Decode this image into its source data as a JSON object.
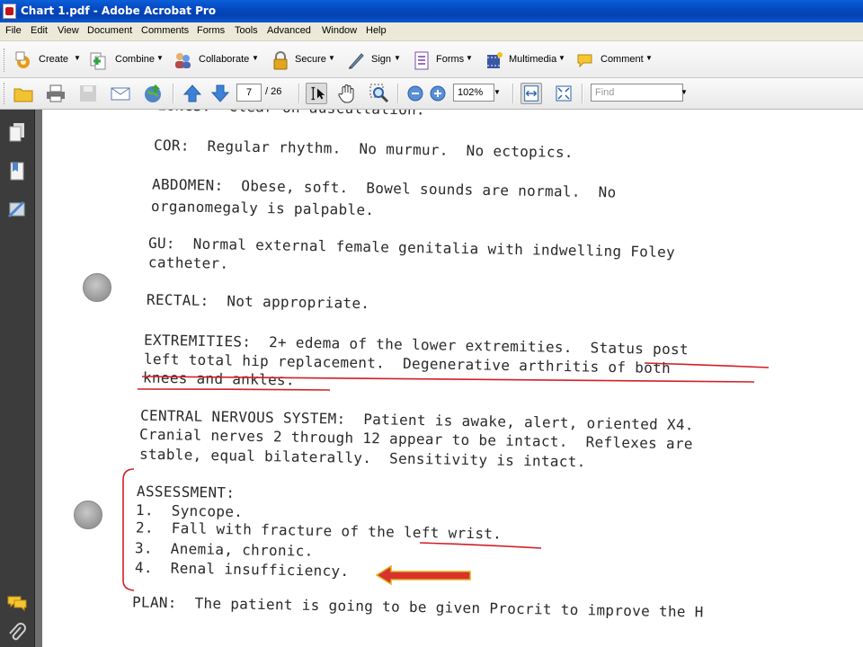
{
  "window": {
    "title": "Chart 1.pdf - Adobe Acrobat Pro"
  },
  "menubar": [
    "File",
    "Edit",
    "View",
    "Document",
    "Comments",
    "Forms",
    "Tools",
    "Advanced",
    "Window",
    "Help"
  ],
  "toolbar1": {
    "create": "Create",
    "combine": "Combine",
    "collaborate": "Collaborate",
    "secure": "Secure",
    "sign": "Sign",
    "forms": "Forms",
    "multimedia": "Multimedia",
    "comment": "Comment"
  },
  "toolbar2": {
    "page_current": "7",
    "page_total": "/ 26",
    "zoom": "102%",
    "find_placeholder": "Find"
  },
  "document": {
    "lines": [
      "LUNGS:  Clear on auscultation.",
      "COR:  Regular rhythm.  No murmur.  No ectopics.",
      "ABDOMEN:  Obese, soft.  Bowel sounds are normal.  No",
      "organomegaly is palpable.",
      "GU:  Normal external female genitalia with indwelling Foley",
      "catheter.",
      "RECTAL:  Not appropriate.",
      "EXTREMITIES:  2+ edema of the lower extremities.  Status post",
      "left total hip replacement.  Degenerative arthritis of both",
      "knees and ankles.",
      "CENTRAL NERVOUS SYSTEM:  Patient is awake, alert, oriented X4.",
      "Cranial nerves 2 through 12 appear to be intact.  Reflexes are",
      "stable, equal bilaterally.  Sensitivity is intact.",
      "ASSESSMENT:",
      "1.  Syncope.",
      "2.  Fall with fracture of the left wrist.",
      "3.  Anemia, chronic.",
      "4.  Renal insufficiency.",
      "PLAN:  The patient is going to be given Procrit to improve the H"
    ]
  },
  "colors": {
    "annotation_red": "#d21f26",
    "arrow_fill": "#d9322a",
    "arrow_edge": "#e0b020"
  }
}
